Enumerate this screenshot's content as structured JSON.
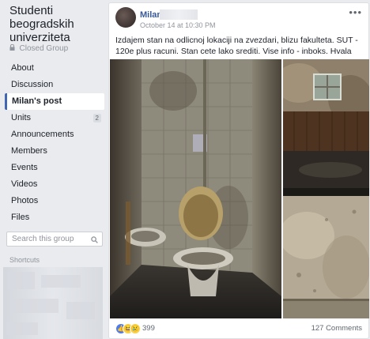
{
  "group": {
    "title": "Studenti beogradskih univerziteta",
    "privacy": "Closed Group"
  },
  "nav": {
    "items": [
      {
        "label": "About"
      },
      {
        "label": "Discussion"
      },
      {
        "label": "Milan's post",
        "active": true
      },
      {
        "label": "Units",
        "badge": "2"
      },
      {
        "label": "Announcements"
      },
      {
        "label": "Members"
      },
      {
        "label": "Events"
      },
      {
        "label": "Videos"
      },
      {
        "label": "Photos"
      },
      {
        "label": "Files"
      }
    ]
  },
  "search": {
    "placeholder": "Search this group"
  },
  "shortcuts": {
    "label": "Shortcuts"
  },
  "post": {
    "author": "Milan",
    "timestamp": "October 14 at 10:30 PM",
    "text": "Izdajem stan na odlicnoj lokaciji na zvezdari, blizu fakulteta. SUT - 120e plus racuni. Stan cete lako srediti. Vise info - inboks. Hvala",
    "more_label": "•••",
    "reaction_count": "399",
    "comments": "127 Comments",
    "reactions": [
      "like",
      "haha",
      "sad"
    ]
  },
  "colors": {
    "accent": "#4267b2",
    "link": "#385898",
    "background": "#e9ebee"
  }
}
